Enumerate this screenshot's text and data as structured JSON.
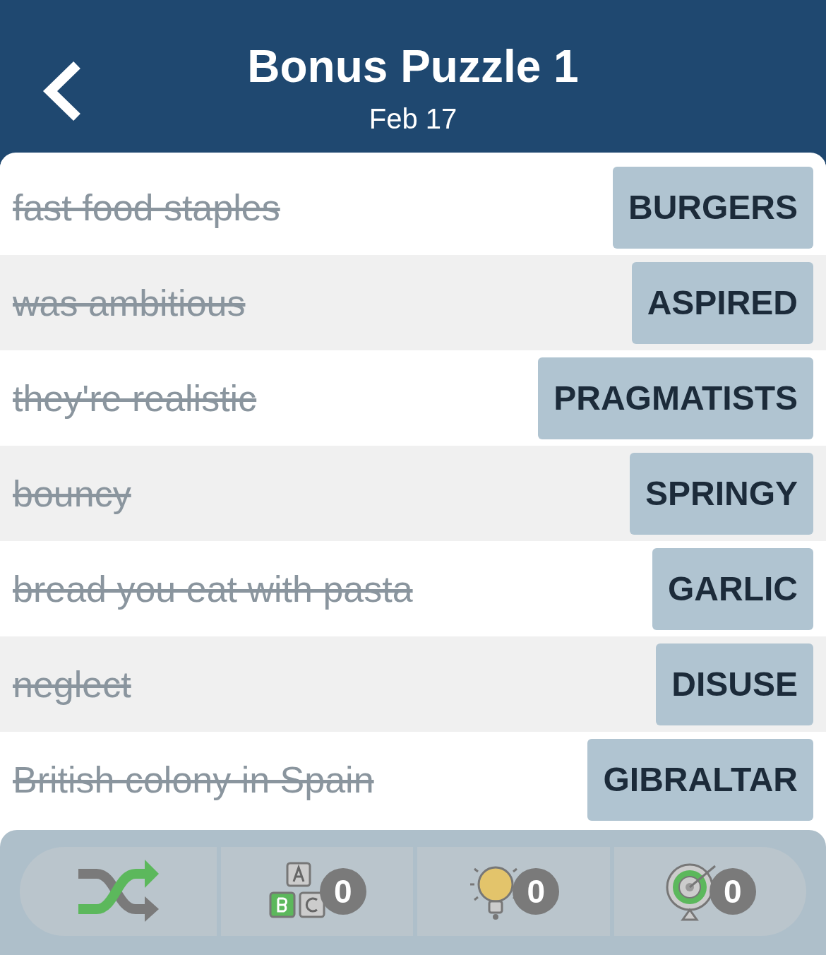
{
  "header": {
    "title": "Bonus Puzzle 1",
    "subtitle": "Feb 17"
  },
  "rows": [
    {
      "clue": "fast food staples",
      "answer": "BURGERS",
      "solved": true
    },
    {
      "clue": "was ambitious",
      "answer": "ASPIRED",
      "solved": true
    },
    {
      "clue": "they're realistic",
      "answer": "PRAGMATISTS",
      "solved": true
    },
    {
      "clue": "bouncy",
      "answer": "SPRINGY",
      "solved": true
    },
    {
      "clue": "bread you eat with pasta",
      "answer": "GARLIC",
      "solved": true
    },
    {
      "clue": "neglect",
      "answer": "DISUSE",
      "solved": true
    },
    {
      "clue": "British colony in Spain",
      "answer": "GIBRALTAR",
      "solved": true
    }
  ],
  "toolbar": [
    {
      "kind": "shuffle"
    },
    {
      "kind": "letters",
      "count": "0"
    },
    {
      "kind": "hint",
      "count": "0"
    },
    {
      "kind": "target",
      "count": "0"
    }
  ]
}
